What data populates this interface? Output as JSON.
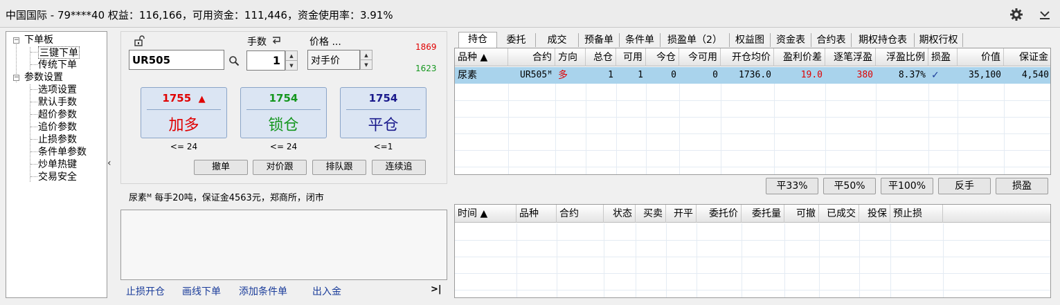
{
  "titlebar": {
    "title": "中国国际 - 79****40  权益：116,166，可用资金：111,446，资金使用率：3.91%",
    "icons": [
      "gear-icon",
      "chevron-down-icon"
    ]
  },
  "tree": {
    "items": [
      {
        "label": "下单板",
        "level": 0,
        "expander": "−"
      },
      {
        "label": "三键下单",
        "level": 1,
        "selected": true
      },
      {
        "label": "传统下单",
        "level": 1
      },
      {
        "label": "参数设置",
        "level": 0,
        "expander": "−"
      },
      {
        "label": "选项设置",
        "level": 1
      },
      {
        "label": "默认手数",
        "level": 1
      },
      {
        "label": "超价参数",
        "level": 1
      },
      {
        "label": "追价参数",
        "level": 1
      },
      {
        "label": "止损参数",
        "level": 1
      },
      {
        "label": "条件单参数",
        "level": 1
      },
      {
        "label": "炒单热键",
        "level": 1
      },
      {
        "label": "交易安全",
        "level": 1
      }
    ],
    "collapse_glyph": "‹"
  },
  "order": {
    "contract": "UR505",
    "qty_label": "手数",
    "qty": "1",
    "price_label": "价格 ...",
    "price_mode": "对手价",
    "upper_price": "1869",
    "lower_price": "1623",
    "buttons": [
      {
        "price": "1755",
        "arrow": "▲",
        "label": "加多",
        "limit": "<= 24",
        "price_color": "#e00000",
        "label_color": "#e00000"
      },
      {
        "price": "1754",
        "arrow": "",
        "label": "锁仓",
        "limit": "<= 24",
        "price_color": "#14961e",
        "label_color": "#14961e"
      },
      {
        "price": "1754",
        "arrow": "",
        "label": "平仓",
        "limit": "<=1",
        "price_color": "#1a1a8c",
        "label_color": "#1a1a8c"
      }
    ],
    "small_buttons": [
      "撤单",
      "对价跟",
      "排队跟",
      "连续追"
    ],
    "info": "尿素ᴹ 每手20吨，保证金4563元，郑商所，闭市"
  },
  "links": [
    "止损开仓",
    "画线下单",
    "添加条件单",
    "出入金"
  ],
  "expand_glyph": ">|",
  "tabs": [
    "持仓",
    "委托",
    "成交",
    "预备单",
    "条件单",
    "损盈单（2）",
    "权益图",
    "资金表",
    "合约表",
    "期权持仓表",
    "期权行权"
  ],
  "positions": {
    "headers": [
      "品种 ▲",
      "合约",
      "方向",
      "总仓",
      "可用",
      "今仓",
      "今可用",
      "开仓均价",
      "盈利价差",
      "逐笔浮盈",
      "浮盈比例",
      "损盈",
      "价值",
      "保证金"
    ],
    "rows": [
      {
        "cells": [
          "尿素",
          "UR505ᴹ",
          "多",
          "1",
          "1",
          "0",
          "0",
          "1736.0",
          "19.0",
          "380",
          "8.37%",
          "✓",
          "35,100",
          "4,540"
        ]
      }
    ]
  },
  "action_buttons": [
    "平33%",
    "平50%",
    "平100%",
    "反手",
    "损盈"
  ],
  "orders": {
    "headers": [
      "时间 ▲",
      "品种",
      "合约",
      "状态",
      "买卖",
      "开平",
      "委托价",
      "委托量",
      "可撤",
      "已成交",
      "投保",
      "预止损"
    ]
  },
  "colors": {
    "red": "#e00000",
    "green": "#14961e",
    "navy": "#1a1a8c",
    "selection": "#a9d3ec",
    "link": "#1a3c9a"
  }
}
